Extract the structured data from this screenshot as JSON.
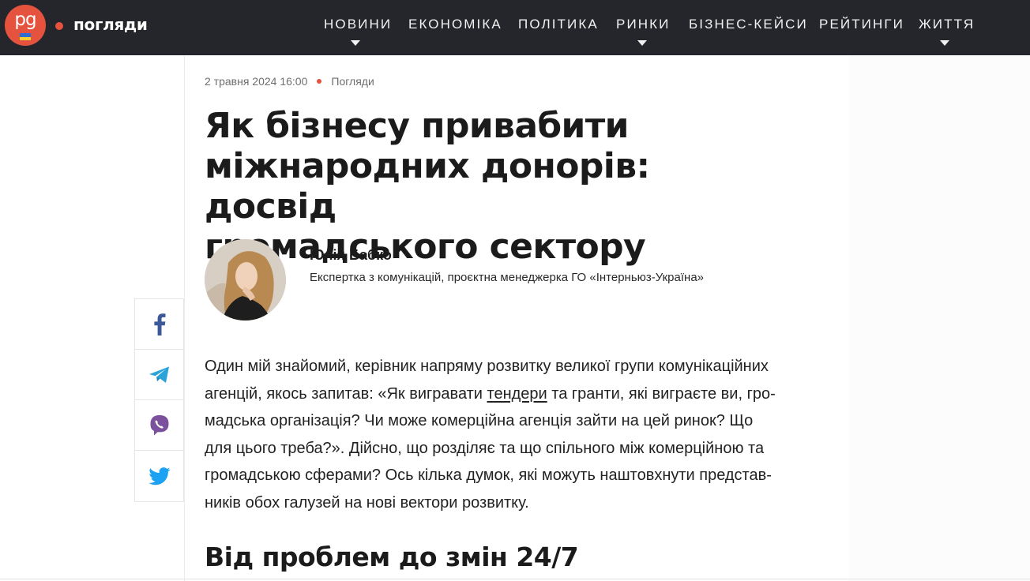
{
  "header": {
    "logo_text": "pg",
    "section_label": "погляди",
    "nav": [
      {
        "label": "НОВИНИ",
        "has_dropdown": true
      },
      {
        "label": "ЕКОНОМІКА",
        "has_dropdown": false
      },
      {
        "label": "ПОЛІТИКА",
        "has_dropdown": false
      },
      {
        "label": "РИНКИ",
        "has_dropdown": true
      },
      {
        "label": "БІЗНЕС-КЕЙСИ",
        "has_dropdown": false
      },
      {
        "label": "РЕЙТИНГИ",
        "has_dropdown": false
      },
      {
        "label": "ЖИТТЯ",
        "has_dropdown": true
      }
    ]
  },
  "share": {
    "icons": [
      "facebook-icon",
      "telegram-icon",
      "viber-icon",
      "twitter-icon"
    ]
  },
  "article": {
    "date": "2 травня 2024 16:00",
    "category": "Погляди",
    "title_lines": [
      "Як бізнесу привабити",
      "міжнародних донорів: досвід",
      "громадського сектору"
    ],
    "author": {
      "name": "Юлія Бабко",
      "role": "Експертка з комунікацій, проєктна менеджерка ГО «Інтерньюз-Україна»"
    },
    "paragraph": {
      "line1": "Один мій знайомий, керівник напряму розвитку великої групи комунікаційних",
      "line2_before": "агенцій, якось запитав: «Як вигравати ",
      "link": "тендери",
      "line2_after": " та гранти, які виграєте ви, гро-",
      "line3": "мадська організація? Чи може комерційна агенція зайти на цей ринок? Що",
      "line4": "для цього треба?». Дійсно, що розділяє та що спільного між комерційною та",
      "line5": "громадською сферами? Ось кілька думок, які можуть наштовхнути представ-",
      "line6": "ників обох галузей на нові вектори розвитку."
    },
    "subheading": "Від проблем до змін 24/7"
  },
  "colors": {
    "topbar": "#25262b",
    "accent": "#e5533e",
    "facebook": "#3b5998",
    "telegram": "#2aa3d9",
    "viber": "#7b519d",
    "twitter": "#1da1f2"
  }
}
